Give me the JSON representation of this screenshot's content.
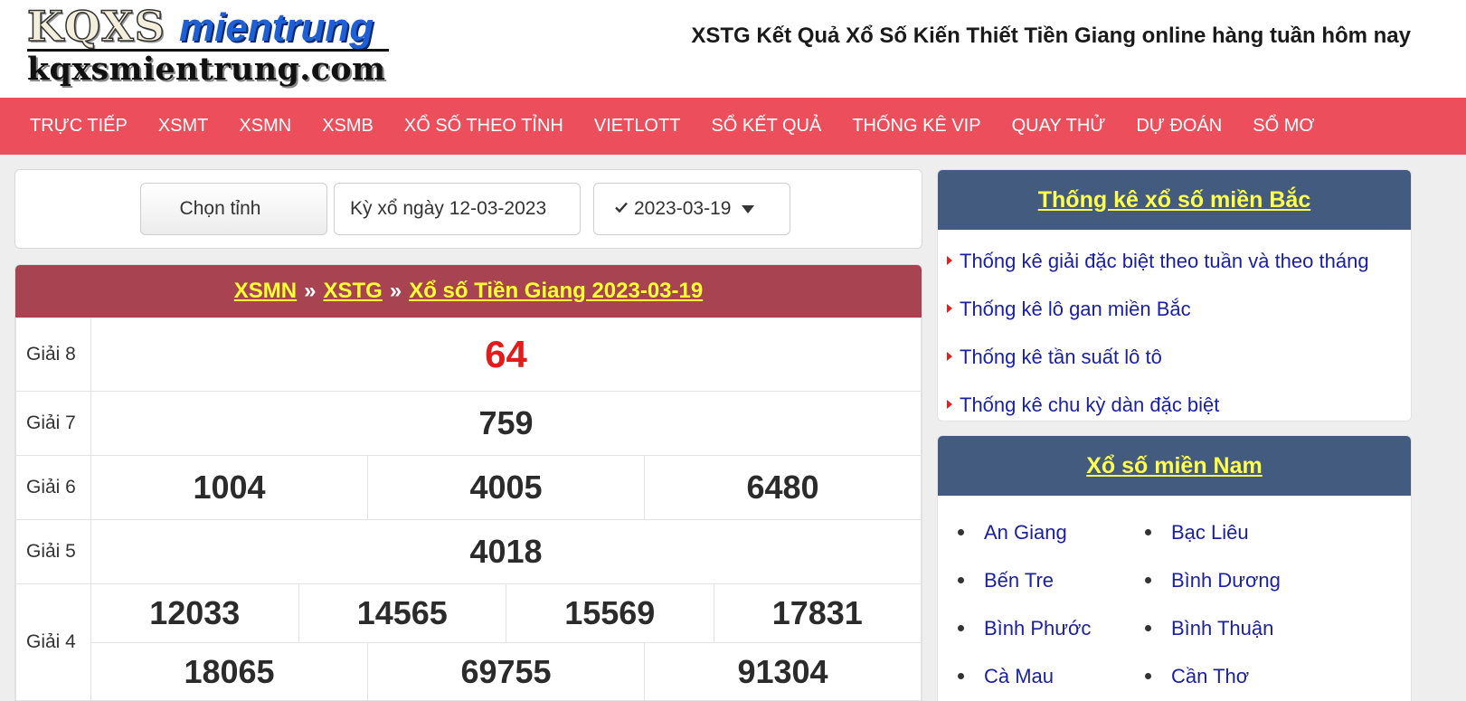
{
  "header": {
    "logo_kqxs": "KQXS",
    "logo_mientrung": "mientrung",
    "logo_domain": "kqxsmientrung.com",
    "site_title": "XSTG Kết Quả Xổ Số Kiến Thiết Tiền Giang online hàng tuần hôm nay"
  },
  "nav": {
    "items": [
      "TRỰC TIẾP",
      "XSMT",
      "XSMN",
      "XSMB",
      "XỔ SỐ THEO TỈNH",
      "VIETLOTT",
      "SỔ KẾT QUẢ",
      "THỐNG KÊ VIP",
      "QUAY THỬ",
      "DỰ ĐOÁN",
      "SỔ MƠ"
    ]
  },
  "selector": {
    "province": "Chọn tỉnh",
    "ky_xo": "Kỳ xổ ngày 12-03-2023",
    "date": "2023-03-19"
  },
  "result": {
    "breadcrumb": [
      "XSMN",
      "XSTG",
      "Xổ số Tiền Giang 2023-03-19"
    ],
    "separator": "»",
    "rows": [
      {
        "label": "Giải 8",
        "lines": [
          [
            "64"
          ]
        ],
        "special": true
      },
      {
        "label": "Giải 7",
        "lines": [
          [
            "759"
          ]
        ]
      },
      {
        "label": "Giải 6",
        "lines": [
          [
            "1004",
            "4005",
            "6480"
          ]
        ]
      },
      {
        "label": "Giải 5",
        "lines": [
          [
            "4018"
          ]
        ]
      },
      {
        "label": "Giải 4",
        "lines": [
          [
            "12033",
            "14565",
            "15569",
            "17831"
          ],
          [
            "18065",
            "69755",
            "91304"
          ]
        ]
      }
    ],
    "special_color": "#e21b1b"
  },
  "sidebar": {
    "thongke": {
      "title": "Thống kê xổ số miền Bắc",
      "items": [
        "Thống kê giải đặc biệt theo tuần và theo tháng",
        "Thống kê lô gan miền Bắc",
        "Thống kê tần suất lô tô",
        "Thống kê chu kỳ dàn đặc biệt"
      ]
    },
    "miennam": {
      "title": "Xổ số miền Nam",
      "items": [
        "An Giang",
        "Bạc Liêu",
        "Bến Tre",
        "Bình Dương",
        "Bình Phước",
        "Bình Thuận",
        "Cà Mau",
        "Cần Thơ"
      ]
    }
  },
  "colors": {
    "nav_bg": "#ec4f5b",
    "result_head_bg": "#a84452",
    "side_head_bg": "#435b7e",
    "link_yellow": "#ffff33",
    "link_blue": "#1b20a3"
  }
}
